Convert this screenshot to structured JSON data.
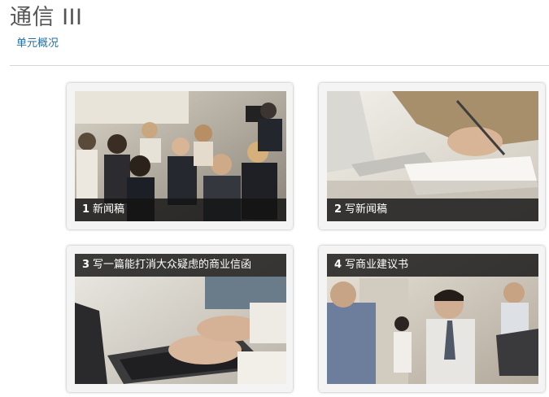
{
  "header": {
    "title": "通信 III",
    "overview_link": "单元概况"
  },
  "cards": [
    {
      "number": "1",
      "label": "新闻稿"
    },
    {
      "number": "2",
      "label": "写新闻稿"
    },
    {
      "number": "3",
      "label": "写一篇能打消大众疑虑的商业信函"
    },
    {
      "number": "4",
      "label": "写商业建议书"
    }
  ],
  "colors": {
    "link": "#2a6f9e",
    "caption_bg": "#141414",
    "title": "#555555"
  }
}
